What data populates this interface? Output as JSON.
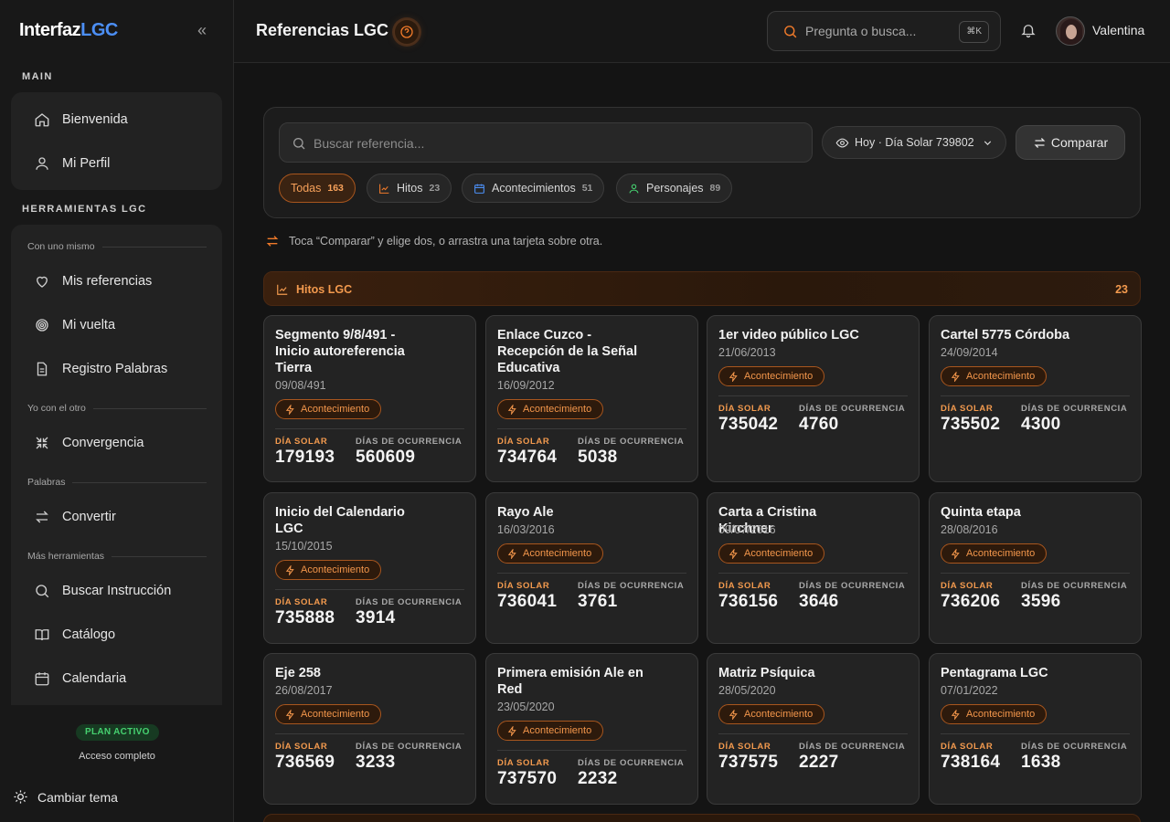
{
  "sidebar": {
    "logo_main": "Interfaz",
    "logo_accent": "LGC",
    "section_main": "MAIN",
    "section_tools": "HERRAMIENTAS LGC",
    "main_items": [
      {
        "label": "Bienvenida",
        "icon": "home-icon"
      },
      {
        "label": "Mi Perfil",
        "icon": "user-icon"
      }
    ],
    "subheads": [
      "Con uno mismo",
      "Yo con el otro",
      "Palabras",
      "Más herramientas"
    ],
    "tool_items": [
      {
        "label": "Mis referencias",
        "icon": "heart-icon"
      },
      {
        "label": "Mi vuelta",
        "icon": "spiral-icon"
      },
      {
        "label": "Registro Palabras",
        "icon": "document-icon"
      },
      {
        "label": "Convergencia",
        "icon": "converge-icon"
      },
      {
        "label": "Convertir",
        "icon": "swap-icon"
      },
      {
        "label": "Buscar Instrucción",
        "icon": "search-icon"
      },
      {
        "label": "Catálogo",
        "icon": "book-icon"
      },
      {
        "label": "Calendaria",
        "icon": "calendar-icon"
      }
    ],
    "plan_badge": "PLAN ACTIVO",
    "plan_sub": "Acceso completo",
    "theme_label": "Cambiar tema"
  },
  "header": {
    "title": "Referencias LGC",
    "search_placeholder": "Pregunta o busca...",
    "shortcut": "⌘K",
    "username": "Valentina"
  },
  "filters": {
    "search_placeholder": "Buscar referencia...",
    "date_label": "Hoy · Día Solar 739802",
    "compare_label": "Comparar",
    "chips": [
      {
        "label": "Todas",
        "count": "163"
      },
      {
        "label": "Hitos",
        "count": "23"
      },
      {
        "label": "Acontecimientos",
        "count": "51"
      },
      {
        "label": "Personajes",
        "count": "89"
      }
    ]
  },
  "hint": "Toca “Comparar” y elige dos, o arrastra una tarjeta sobre otra.",
  "section": {
    "name": "Hitos LGC",
    "count": "23"
  },
  "card_labels": {
    "solar": "DÍA SOLAR",
    "ocurrencia": "DÍAS DE OCURRENCIA"
  },
  "cards": [
    {
      "title": "Segmento 9/8/491 - Inicio autoreferencia Tierra",
      "date": "09/08/491",
      "badge": "Acontecimiento",
      "solar": "179193",
      "ocurrencia": "560609"
    },
    {
      "title": "Enlace Cuzco - Recepción de la Señal Educativa",
      "date": "16/09/2012",
      "badge": "Acontecimiento",
      "solar": "734764",
      "ocurrencia": "5038"
    },
    {
      "title": "1er video público LGC",
      "date": "21/06/2013",
      "badge": "Acontecimiento",
      "solar": "735042",
      "ocurrencia": "4760"
    },
    {
      "title": "Cartel 5775 Córdoba",
      "date": "24/09/2014",
      "badge": "Acontecimiento",
      "solar": "735502",
      "ocurrencia": "4300"
    },
    {
      "title": "Inicio del Calendario LGC",
      "date": "15/10/2015",
      "badge": "Acontecimiento",
      "solar": "735888",
      "ocurrencia": "3914"
    },
    {
      "title": "Rayo Ale",
      "date": "16/03/2016",
      "badge": "Acontecimiento",
      "solar": "736041",
      "ocurrencia": "3761"
    },
    {
      "title": "Carta a Cristina Kirchner",
      "date": "09/07/2016",
      "badge": "Acontecimiento",
      "solar": "736156",
      "ocurrencia": "3646"
    },
    {
      "title": "Quinta etapa",
      "date": "28/08/2016",
      "badge": "Acontecimiento",
      "solar": "736206",
      "ocurrencia": "3596"
    },
    {
      "title": "Eje 258",
      "date": "26/08/2017",
      "badge": "Acontecimiento",
      "solar": "736569",
      "ocurrencia": "3233"
    },
    {
      "title": "Primera emisión Ale en Red",
      "date": "23/05/2020",
      "badge": "Acontecimiento",
      "solar": "737570",
      "ocurrencia": "2232"
    },
    {
      "title": "Matriz Psíquica",
      "date": "28/05/2020",
      "badge": "Acontecimiento",
      "solar": "737575",
      "ocurrencia": "2227"
    },
    {
      "title": "Pentagrama LGC",
      "date": "07/01/2022",
      "badge": "Acontecimiento",
      "solar": "738164",
      "ocurrencia": "1638"
    }
  ]
}
